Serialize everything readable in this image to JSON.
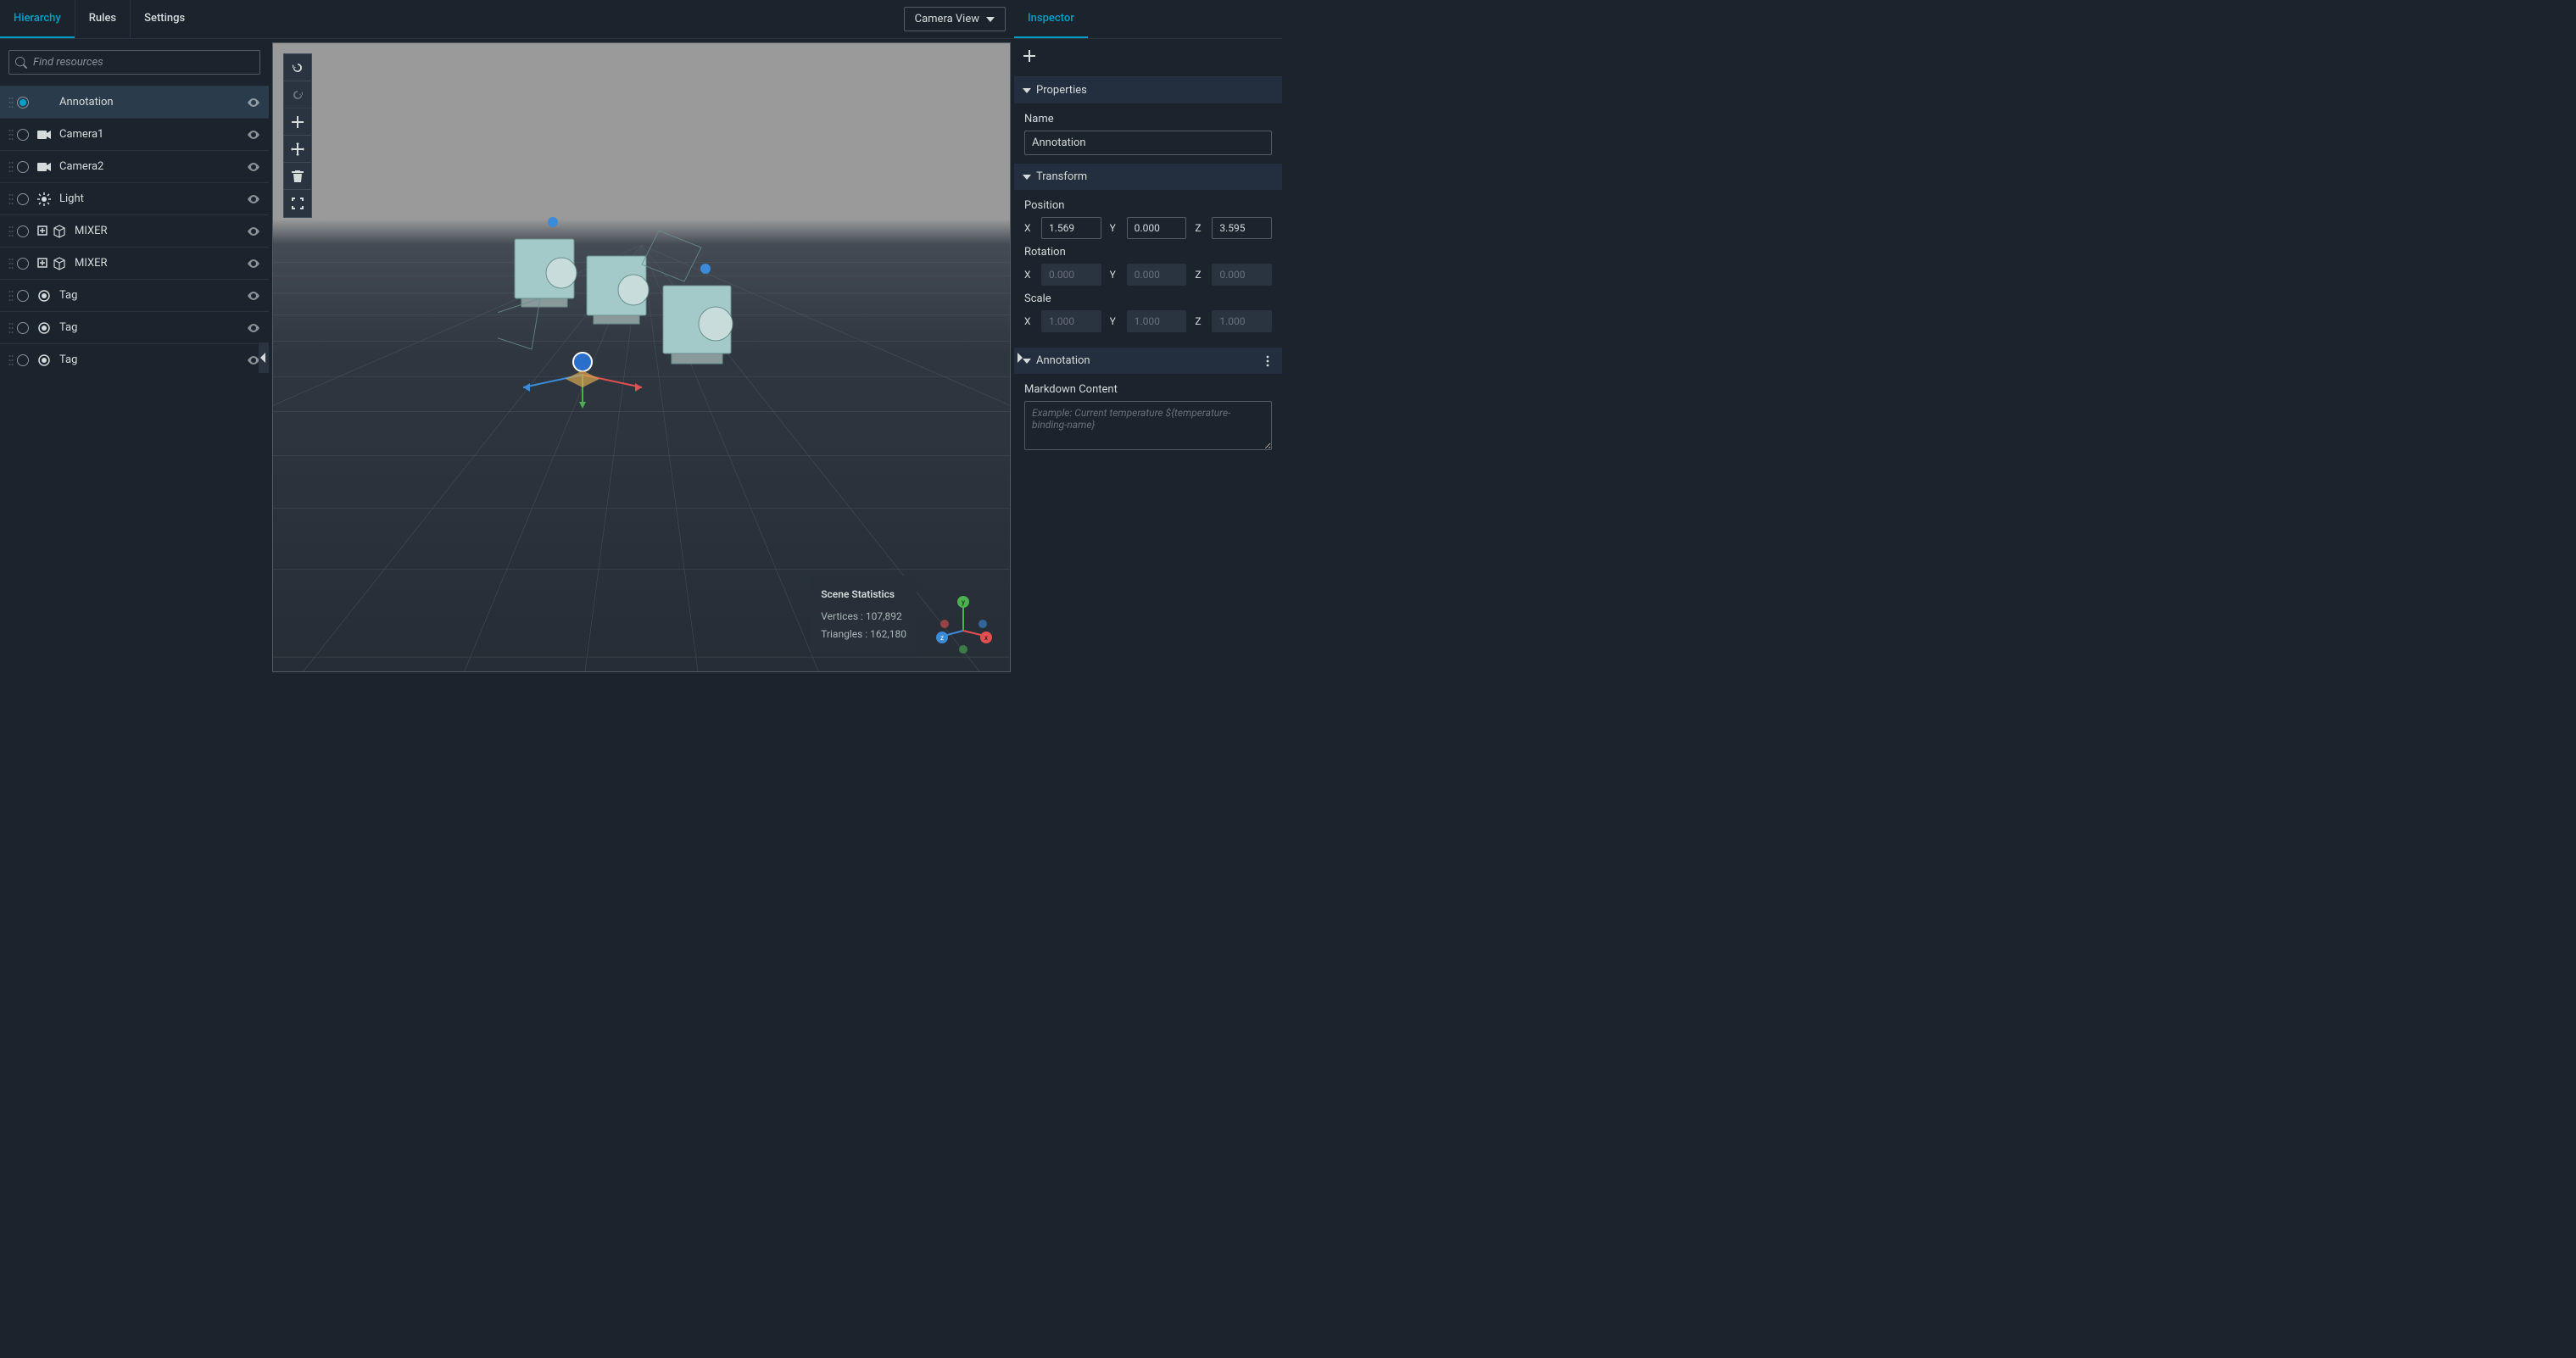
{
  "leftTabs": {
    "hierarchy": "Hierarchy",
    "rules": "Rules",
    "settings": "Settings"
  },
  "search": {
    "placeholder": "Find resources"
  },
  "hierarchy": {
    "items": [
      {
        "label": "Annotation",
        "icon": "none",
        "selected": true,
        "expandable": false
      },
      {
        "label": "Camera1",
        "icon": "camera",
        "selected": false,
        "expandable": false
      },
      {
        "label": "Camera2",
        "icon": "camera",
        "selected": false,
        "expandable": false
      },
      {
        "label": "Light",
        "icon": "light",
        "selected": false,
        "expandable": false
      },
      {
        "label": "MIXER",
        "icon": "cube",
        "selected": false,
        "expandable": true
      },
      {
        "label": "MIXER",
        "icon": "cube",
        "selected": false,
        "expandable": true
      },
      {
        "label": "Tag",
        "icon": "tag",
        "selected": false,
        "expandable": false
      },
      {
        "label": "Tag",
        "icon": "tag",
        "selected": false,
        "expandable": false
      },
      {
        "label": "Tag",
        "icon": "tag",
        "selected": false,
        "expandable": false
      }
    ]
  },
  "cameraView": {
    "label": "Camera View"
  },
  "stats": {
    "title": "Scene Statistics",
    "verticesLabel": "Vertices :",
    "verticesValue": "107,892",
    "trianglesLabel": "Triangles :",
    "trianglesValue": "162,180"
  },
  "inspector": {
    "tab": "Inspector",
    "sections": {
      "properties": "Properties",
      "transform": "Transform",
      "annotation": "Annotation"
    },
    "nameLabel": "Name",
    "nameValue": "Annotation",
    "positionLabel": "Position",
    "rotationLabel": "Rotation",
    "scaleLabel": "Scale",
    "position": {
      "x": "1.569",
      "y": "0.000",
      "z": "3.595"
    },
    "rotation": {
      "x": "0.000",
      "y": "0.000",
      "z": "0.000"
    },
    "scale": {
      "x": "1.000",
      "y": "1.000",
      "z": "1.000"
    },
    "markdownLabel": "Markdown Content",
    "markdownPlaceholder": "Example: Current temperature ${temperature-binding-name}"
  }
}
